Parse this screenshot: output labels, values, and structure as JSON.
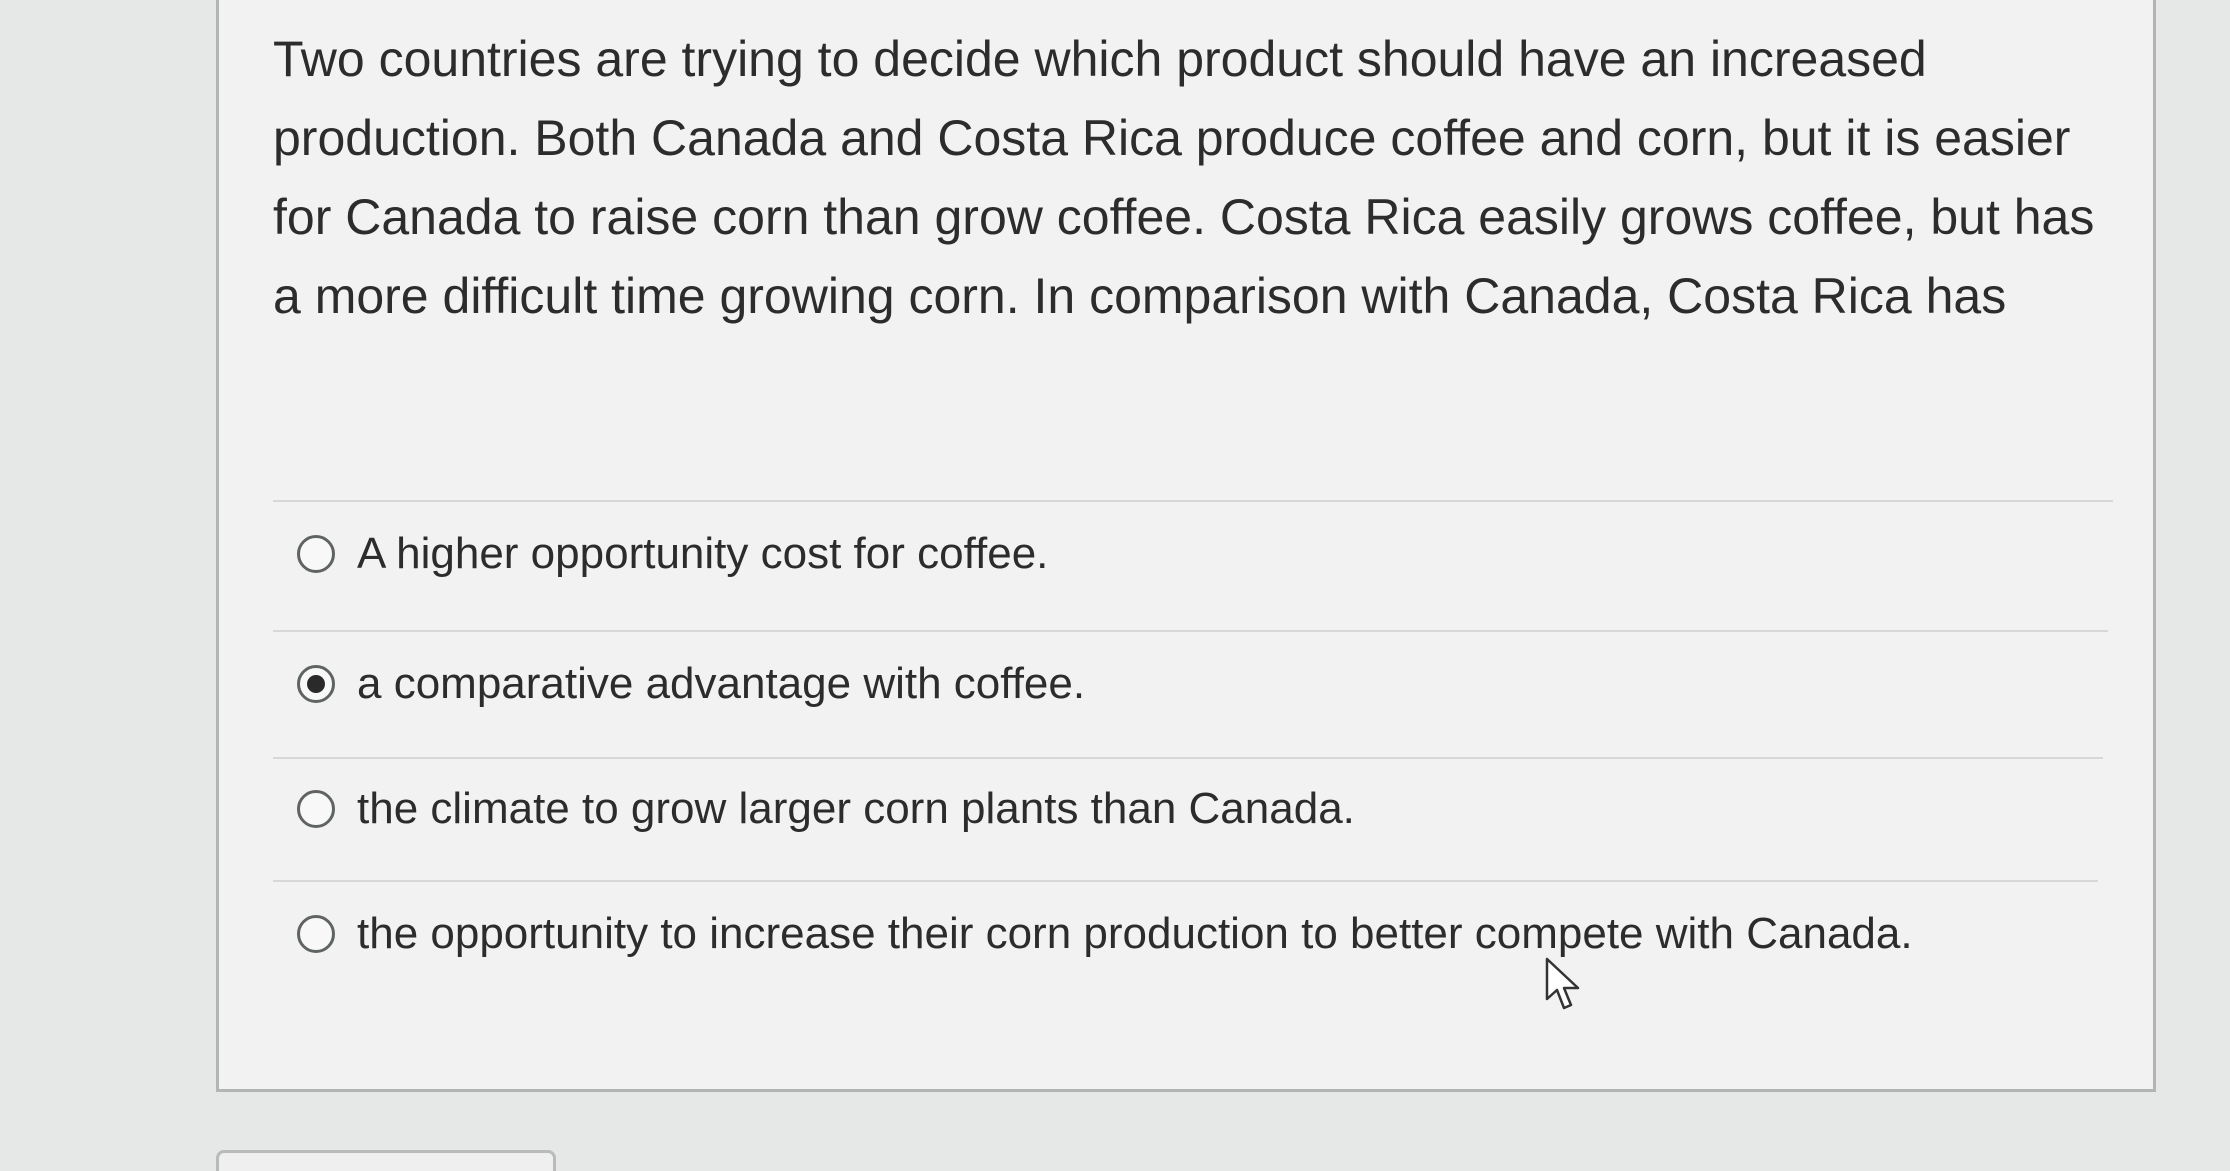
{
  "question": {
    "text": "Two countries are trying to decide which product should have an increased production. Both Canada and Costa Rica produce coffee and corn, but it is easier for Canada to raise corn than grow coffee. Costa Rica easily grows coffee, but has a more difficult time growing corn. In comparison with Canada, Costa Rica has"
  },
  "options": [
    {
      "label": "A higher opportunity cost for coffee.",
      "selected": false
    },
    {
      "label": "a comparative advantage with coffee.",
      "selected": true
    },
    {
      "label": "the climate to grow larger corn plants than Canada.",
      "selected": false
    },
    {
      "label": "the opportunity to increase their corn production to better compete with Canada.",
      "selected": false
    }
  ],
  "icons": {
    "cursor": "mouse-pointer-icon",
    "radio_unselected": "radio-empty-icon",
    "radio_selected": "radio-filled-icon"
  }
}
